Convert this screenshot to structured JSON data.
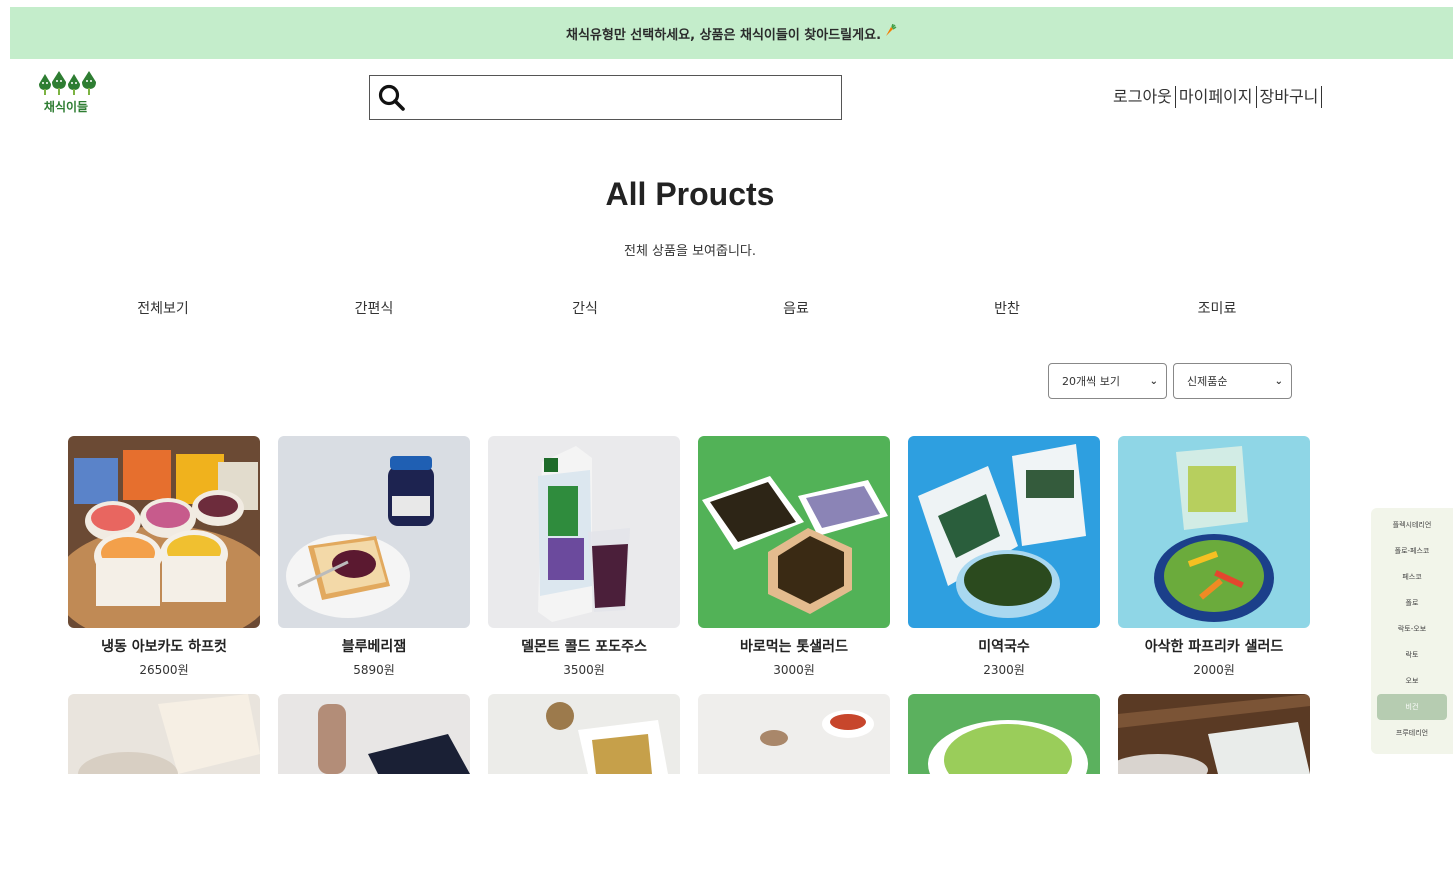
{
  "banner": {
    "text": "채식유형만 선택하세요, 상품은 채식이들이 찾아드릴게요.",
    "carrot_icon": "carrot-icon"
  },
  "brand": {
    "name": "채식이들",
    "icon": "trees-logo-icon"
  },
  "search": {
    "value": "",
    "placeholder": "",
    "icon": "search-icon"
  },
  "user_nav": {
    "logout": "로그아웃",
    "mypage": "마이페이지",
    "cart": "장바구니"
  },
  "page": {
    "title": "All Proucts",
    "subtitle": "전체 상품을 보여줍니다."
  },
  "categories": [
    "전체보기",
    "간편식",
    "간식",
    "음료",
    "반찬",
    "조미료"
  ],
  "controls": {
    "page_size": "20개씩 보기",
    "sort": "신제품순"
  },
  "products": [
    {
      "name": "냉동 아보카도 하프컷",
      "price": "26500원"
    },
    {
      "name": "블루베리잼",
      "price": "5890원"
    },
    {
      "name": "델몬트 콜드 포도주스",
      "price": "3500원"
    },
    {
      "name": "바로먹는 톳샐러드",
      "price": "3000원"
    },
    {
      "name": "미역국수",
      "price": "2300원"
    },
    {
      "name": "아삭한 파프리카 샐러드",
      "price": "2000원"
    }
  ],
  "vegan_types": {
    "items": [
      "플렉시테리언",
      "폴로-페스코",
      "페스코",
      "폴로",
      "락토-오보",
      "락토",
      "오보",
      "비건",
      "프루테리언"
    ],
    "selected": "비건"
  },
  "colors": {
    "banner_bg": "#c4edcb",
    "brand_green": "#2e7d32",
    "sidebar_active": "#b6ccb1"
  }
}
